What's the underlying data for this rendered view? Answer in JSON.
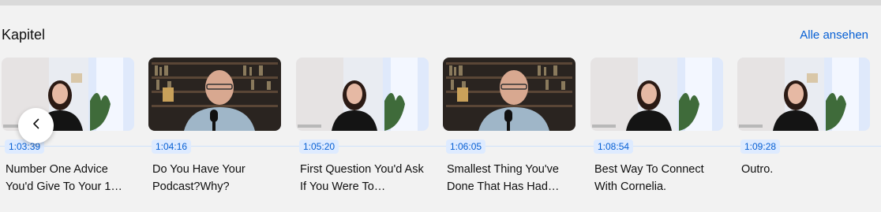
{
  "section": {
    "title": "Kapitel",
    "see_all": "Alle ansehen"
  },
  "chapters": [
    {
      "time": "1:03:39",
      "title": "Number One Advice You'd Give To Your 1…",
      "thumb": "woman"
    },
    {
      "time": "1:04:16",
      "title": "Do You Have Your Podcast?Why?",
      "thumb": "man"
    },
    {
      "time": "1:05:20",
      "title": "First Question You'd Ask If You Were To…",
      "thumb": "woman"
    },
    {
      "time": "1:06:05",
      "title": "Smallest Thing You've Done That Has Had…",
      "thumb": "man"
    },
    {
      "time": "1:08:54",
      "title": "Best Way To Connect With Cornelia.",
      "thumb": "woman"
    },
    {
      "time": "1:09:28",
      "title": "Outro.",
      "thumb": "woman"
    }
  ],
  "icons": {
    "prev": "chevron-left-icon"
  },
  "colors": {
    "accent": "#065fd4",
    "timestamp_bg": "#deebff",
    "background": "#f2f2f2"
  }
}
